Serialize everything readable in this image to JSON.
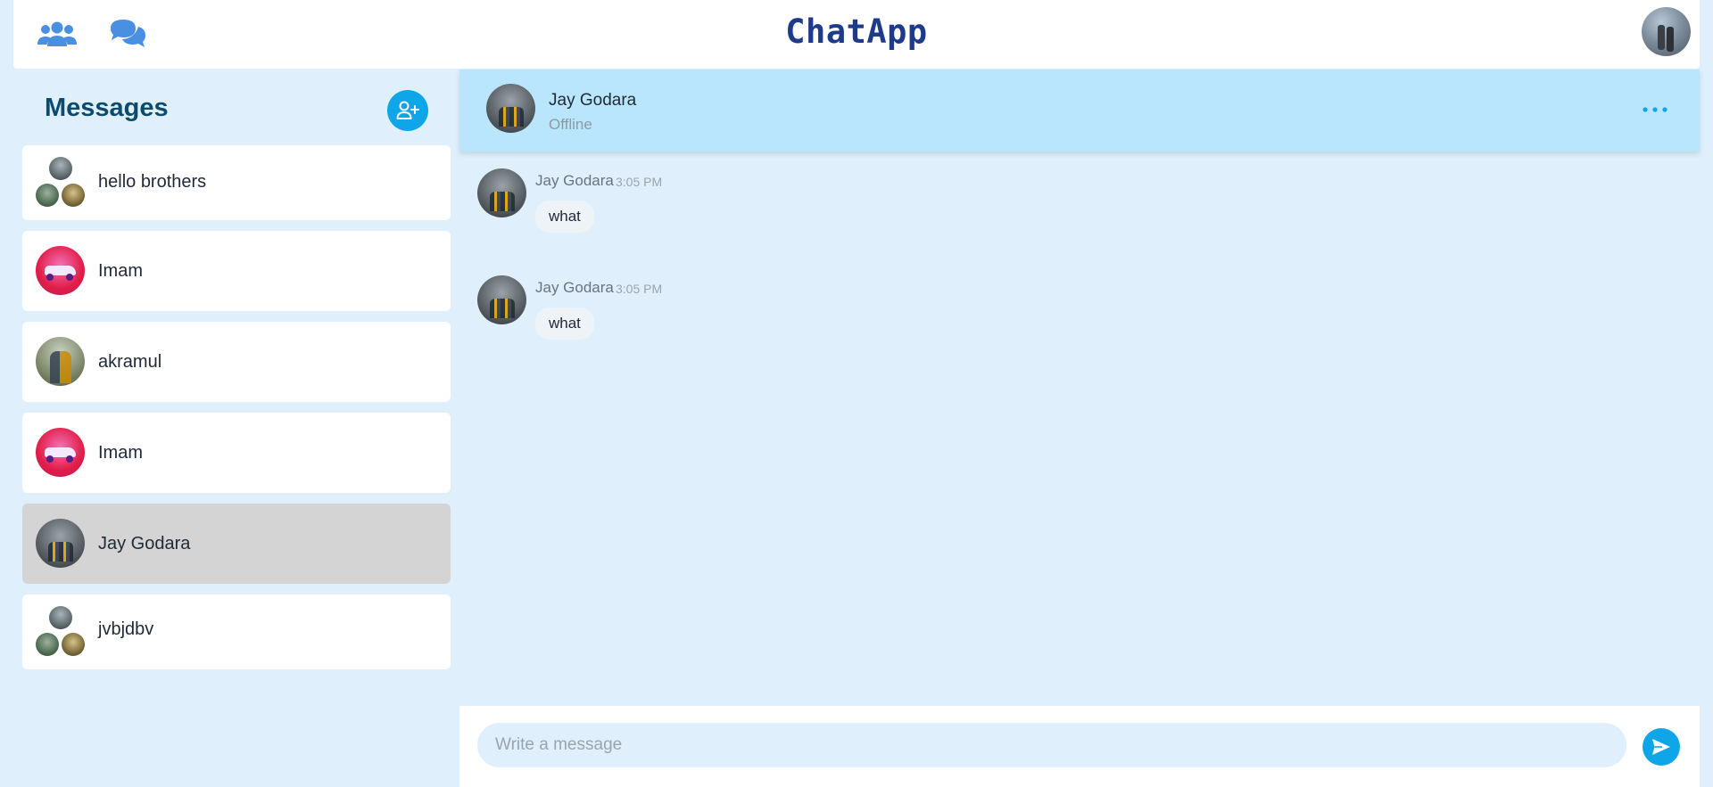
{
  "app": {
    "title": "ChatApp"
  },
  "topbar": {
    "icons": [
      "users-icon",
      "chat-bubbles-icon"
    ],
    "accent_color": "#4a90e2"
  },
  "sidebar": {
    "title": "Messages",
    "new_chat_icon": "user-plus-icon",
    "chats": [
      {
        "name": "hello brothers",
        "type": "group"
      },
      {
        "name": "Imam",
        "type": "direct"
      },
      {
        "name": "akramul",
        "type": "direct"
      },
      {
        "name": "Imam",
        "type": "direct"
      },
      {
        "name": "Jay Godara",
        "type": "direct",
        "active": true
      },
      {
        "name": "jvbjdbv",
        "type": "group"
      }
    ]
  },
  "conversation": {
    "name": "Jay Godara",
    "status": "Offline",
    "more_icon": "ellipsis-icon",
    "messages": [
      {
        "sender": "Jay Godara",
        "time": "3:05 PM",
        "text": "what"
      },
      {
        "sender": "Jay Godara",
        "time": "3:05 PM",
        "text": "what"
      }
    ],
    "composer": {
      "placeholder": "Write a message",
      "send_icon": "send-icon"
    }
  },
  "colors": {
    "background": "#dff0fc",
    "header": "#bae6fd",
    "primary": "#0ea5e9",
    "title": "#1e3a8a",
    "active_item": "#d4d4d4"
  }
}
